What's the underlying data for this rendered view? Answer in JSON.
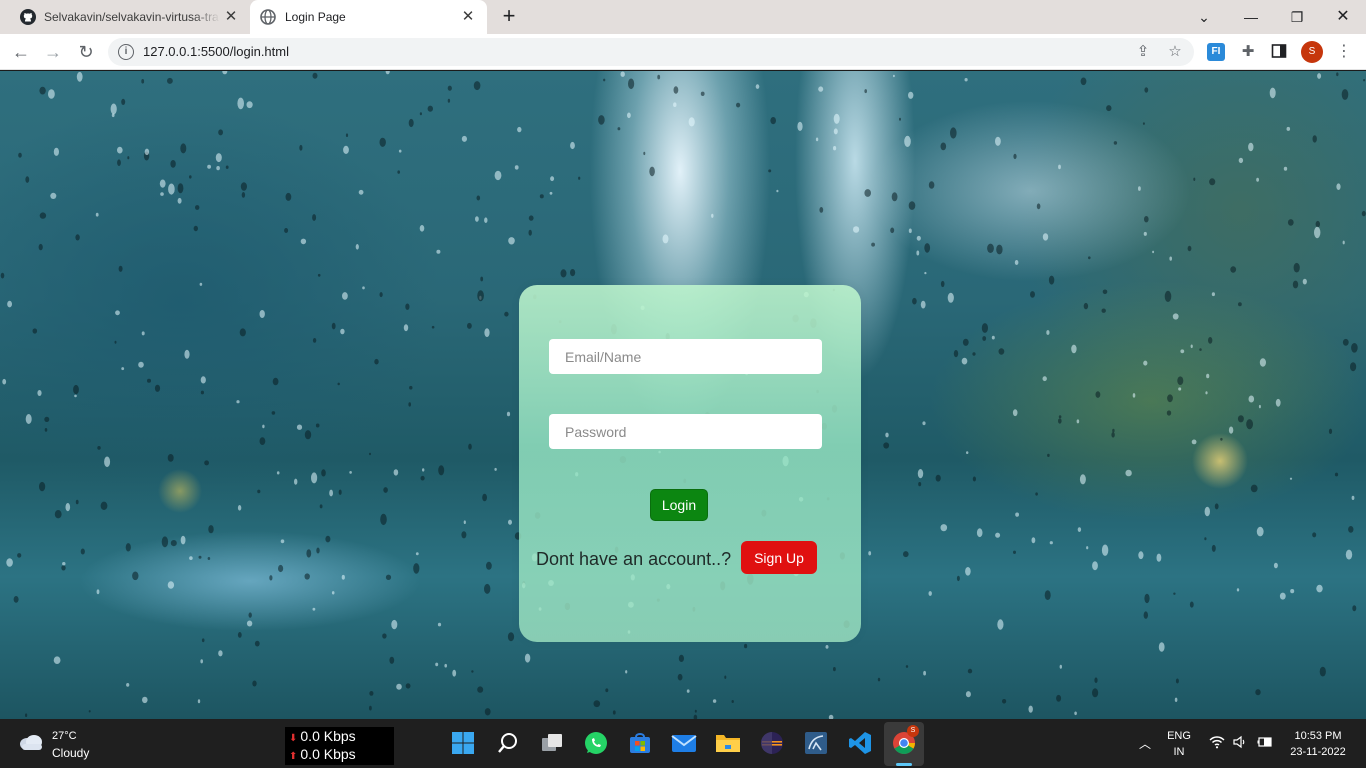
{
  "browser": {
    "tabs": [
      {
        "title": "Selvakavin/selvakavin-virtusa-tra"
      },
      {
        "title": "Login Page"
      }
    ],
    "address": {
      "url": "127.0.0.1:5500/login.html"
    },
    "profile_initial": "S",
    "extension_label": "FI"
  },
  "login_form": {
    "email_placeholder": "Email/Name",
    "password_placeholder": "Password",
    "login_label": "Login",
    "signup_prompt": "Dont have an account..?",
    "signup_label": "Sign Up"
  },
  "colors": {
    "login_button": "#0c8611",
    "signup_button": "#e01010",
    "card": "#a6e8c3"
  },
  "taskbar": {
    "weather": {
      "temp": "27°C",
      "condition": "Cloudy"
    },
    "network": {
      "down": "0.0 Kbps",
      "up": "0.0 Kbps"
    },
    "chrome_badge": "S",
    "language": {
      "primary": "ENG",
      "region": "IN"
    },
    "clock": {
      "time": "10:53 PM",
      "date": "23-11-2022"
    }
  }
}
